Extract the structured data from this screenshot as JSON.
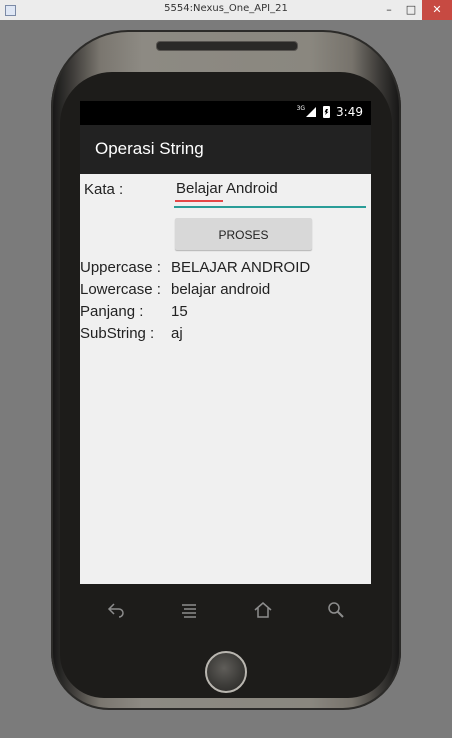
{
  "window": {
    "title": "5554:Nexus_One_API_21",
    "controls": {
      "minimize": "–",
      "maximize": "□",
      "close": "✕"
    }
  },
  "status_bar": {
    "network": "3G",
    "time": "3:49"
  },
  "app": {
    "title": "Operasi String",
    "input": {
      "label": "Kata :",
      "value": "Belajar Android"
    },
    "button": "PROSES",
    "results": [
      {
        "label": "Uppercase :",
        "value": "BELAJAR ANDROID"
      },
      {
        "label": "Lowercase :",
        "value": "belajar android"
      },
      {
        "label": "Panjang :",
        "value": "15"
      },
      {
        "label": "SubString :",
        "value": "aj"
      }
    ]
  },
  "nav": {
    "back_icon": "back-icon",
    "menu_icon": "menu-icon",
    "home_icon": "home-icon",
    "search_icon": "search-icon"
  },
  "colors": {
    "accent": "#2a9d98",
    "spellcheck": "#e54848",
    "action_bar": "#222222",
    "screen_background": "#f0f0f0"
  }
}
